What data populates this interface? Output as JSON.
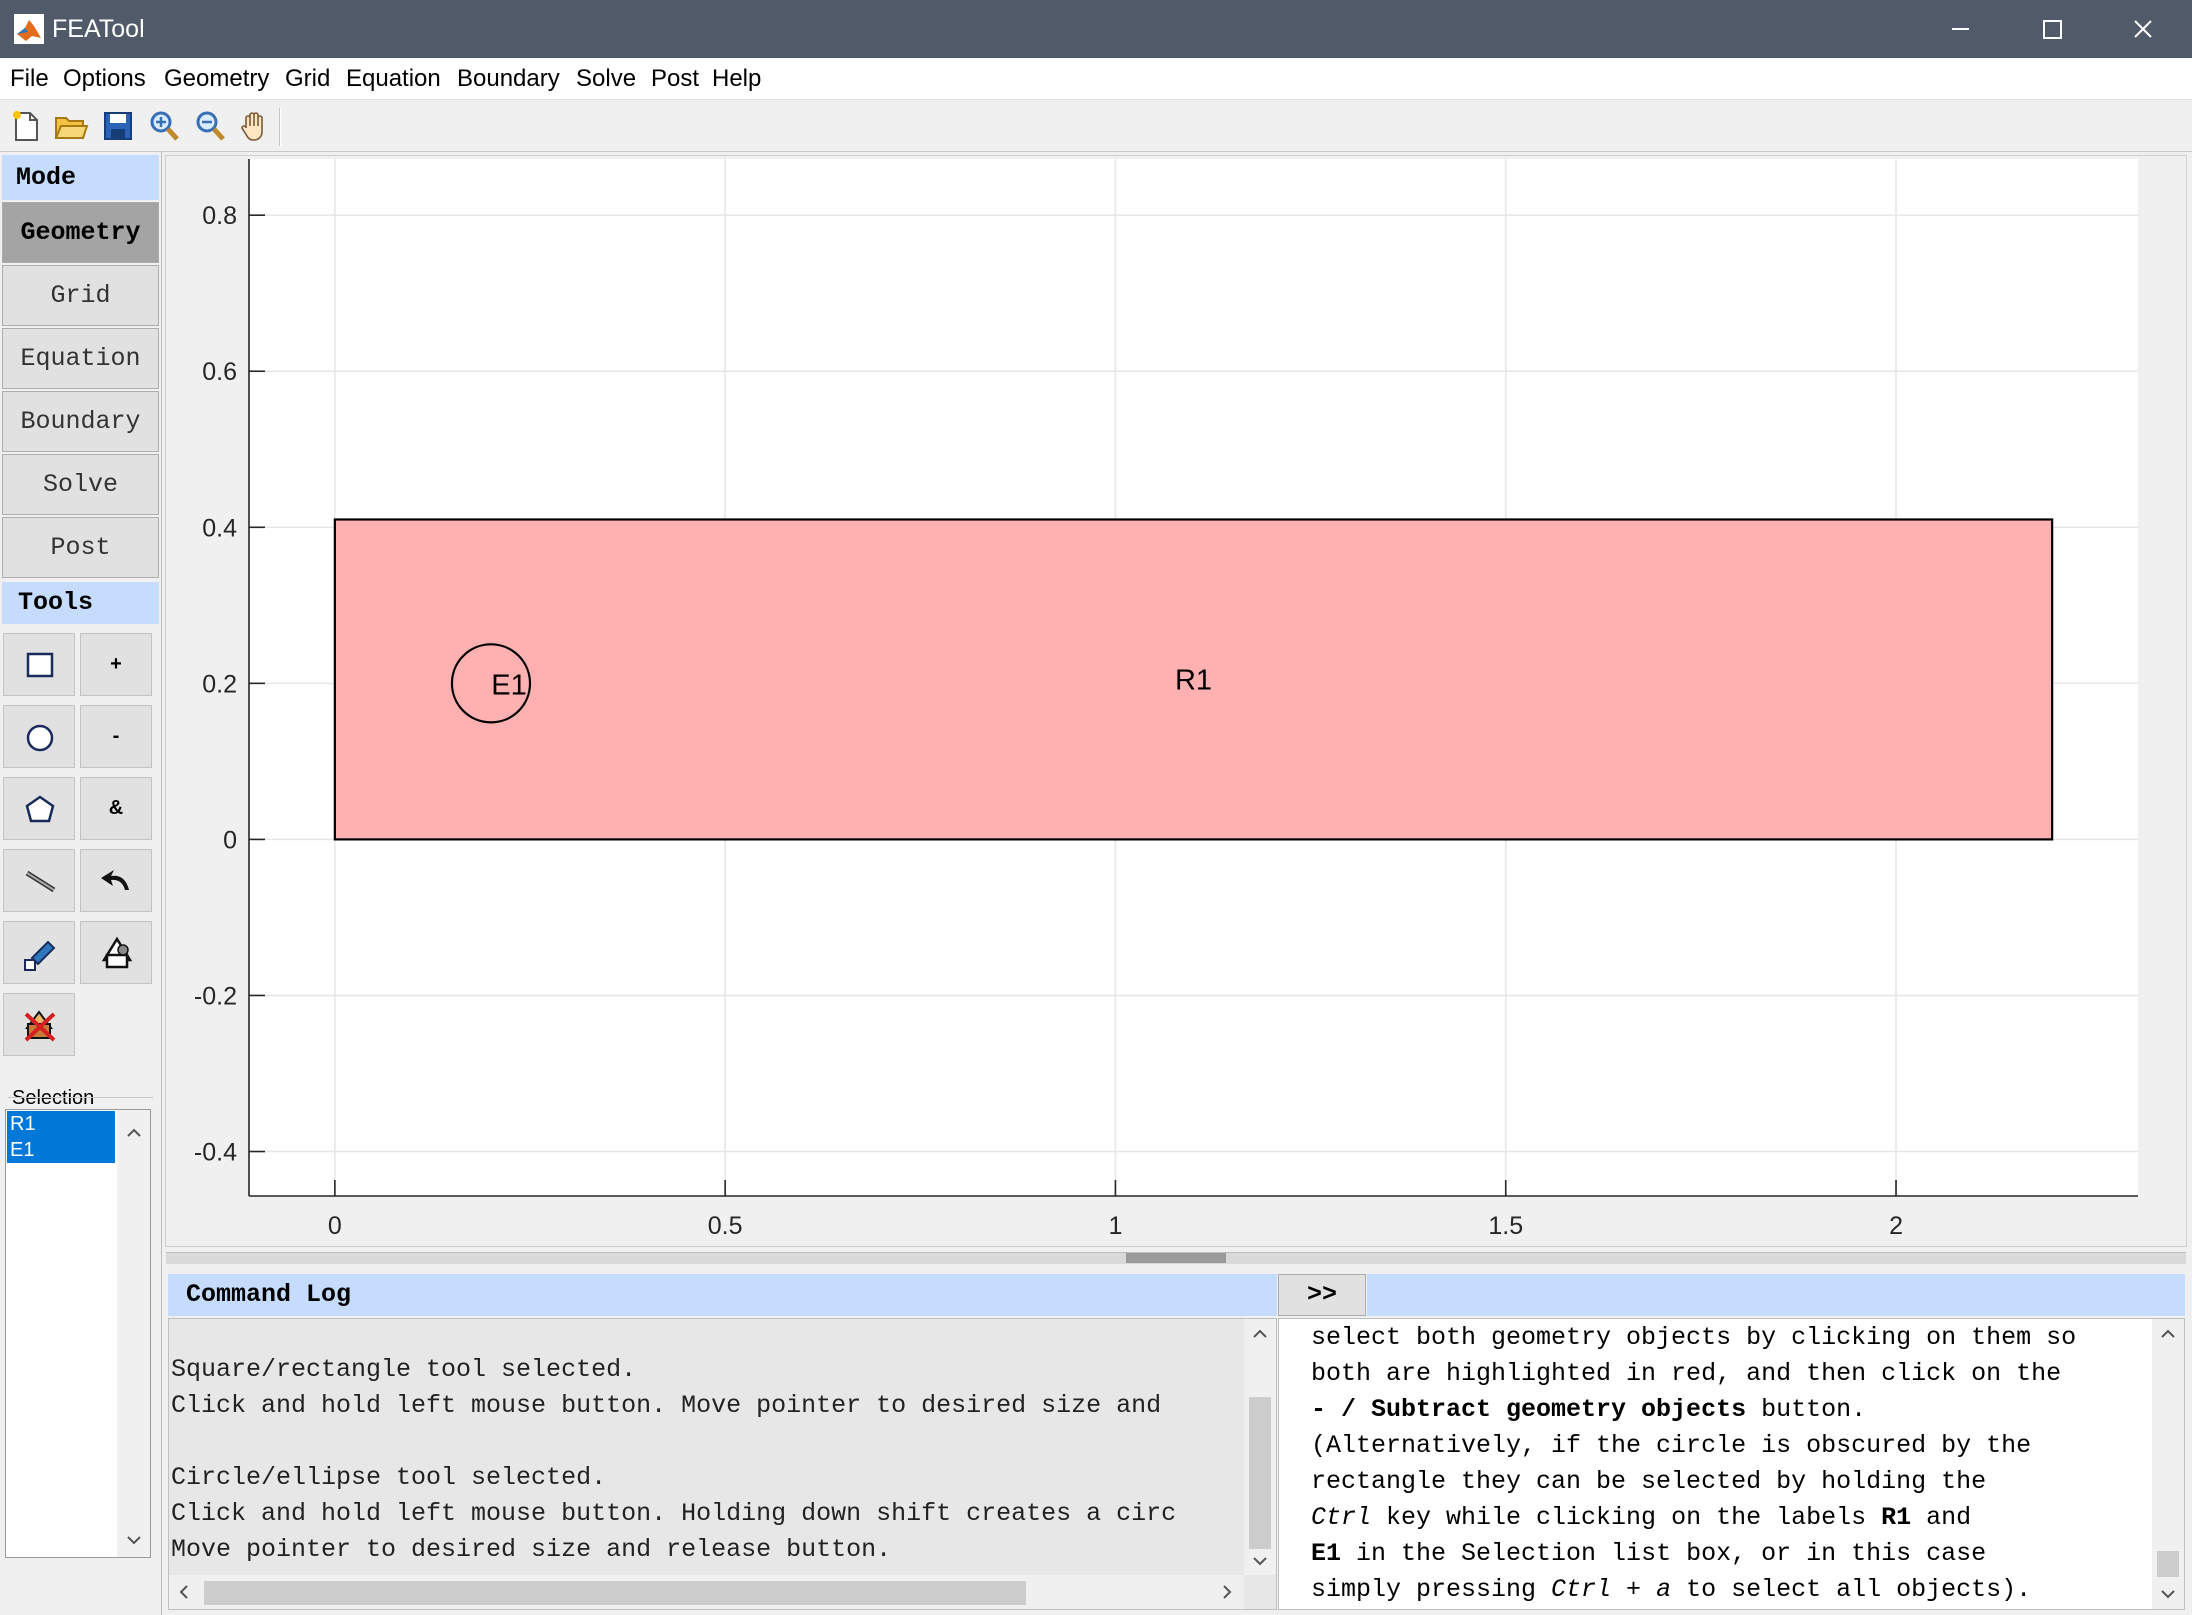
{
  "window": {
    "title": "FEATool"
  },
  "menu": [
    "File",
    "Options",
    "Geometry",
    "Grid",
    "Equation",
    "Boundary",
    "Solve",
    "Post",
    "Help"
  ],
  "toolbar": {
    "icons": [
      "new-file-icon",
      "open-folder-icon",
      "save-icon",
      "zoom-in-icon",
      "zoom-out-icon",
      "pan-hand-icon"
    ]
  },
  "sidebar": {
    "mode_header": "Mode",
    "modes": [
      "Geometry",
      "Grid",
      "Equation",
      "Boundary",
      "Solve",
      "Post"
    ],
    "active_mode": "Geometry",
    "tools_header": "Tools",
    "tool_labels": {
      "union": "+",
      "subtract": "-",
      "intersect": "&"
    },
    "selection_label": "Selection",
    "selection_items": [
      "R1",
      "E1"
    ]
  },
  "plot": {
    "x_ticks": [
      "0",
      "0.5",
      "1",
      "1.5",
      "2"
    ],
    "y_ticks": [
      "0.8",
      "0.6",
      "0.4",
      "0.2",
      "0",
      "-0.2",
      "-0.4"
    ],
    "xlim": [
      -0.11,
      2.31
    ],
    "ylim": [
      -0.457,
      0.872
    ],
    "grid": true,
    "objects": [
      {
        "label": "R1",
        "type": "rectangle",
        "x": [
          0,
          2.2
        ],
        "y": [
          0,
          0.41
        ],
        "fill": "#ffb0b0",
        "stroke": "#000000"
      },
      {
        "label": "E1",
        "type": "circle",
        "cx": 0.2,
        "cy": 0.2,
        "r": 0.05,
        "fill": "none",
        "stroke": "#000000"
      }
    ]
  },
  "command_log": {
    "title": "Command Log",
    "toggle_label": ">>",
    "lines": [
      "",
      "Square/rectangle tool selected.",
      "Click and hold left mouse button. Move pointer to desired size and",
      "",
      "Circle/ellipse tool selected.",
      "Click and hold left mouse button. Holding down shift creates a circ",
      "Move pointer to desired size and release button."
    ]
  },
  "help_text": {
    "lines": [
      [
        {
          "t": "select both geometry objects by clicking on them so",
          "s": ""
        }
      ],
      [
        {
          "t": "both are highlighted in red, and then click on the",
          "s": ""
        }
      ],
      [
        {
          "t": "- / Subtract geometry objects",
          "s": "b"
        },
        {
          "t": " button.",
          "s": ""
        }
      ],
      [
        {
          "t": "(Alternatively, if the circle is obscured by the",
          "s": ""
        }
      ],
      [
        {
          "t": "rectangle they can be selected by holding the",
          "s": ""
        }
      ],
      [
        {
          "t": "Ctrl",
          "s": "i"
        },
        {
          "t": " key while clicking on the labels ",
          "s": ""
        },
        {
          "t": "R1",
          "s": "b"
        },
        {
          "t": " and",
          "s": ""
        }
      ],
      [
        {
          "t": "E1",
          "s": "b"
        },
        {
          "t": " in the Selection list box, or in this case",
          "s": ""
        }
      ],
      [
        {
          "t": "simply pressing ",
          "s": ""
        },
        {
          "t": "Ctrl + a",
          "s": "i"
        },
        {
          "t": " to select all objects).",
          "s": ""
        }
      ]
    ]
  },
  "colors": {
    "header_bg": "#c5dcff",
    "selection_bg": "#0078d7",
    "active_mode_bg": "#a4a4a4",
    "shape_fill": "#ffb0b0"
  }
}
